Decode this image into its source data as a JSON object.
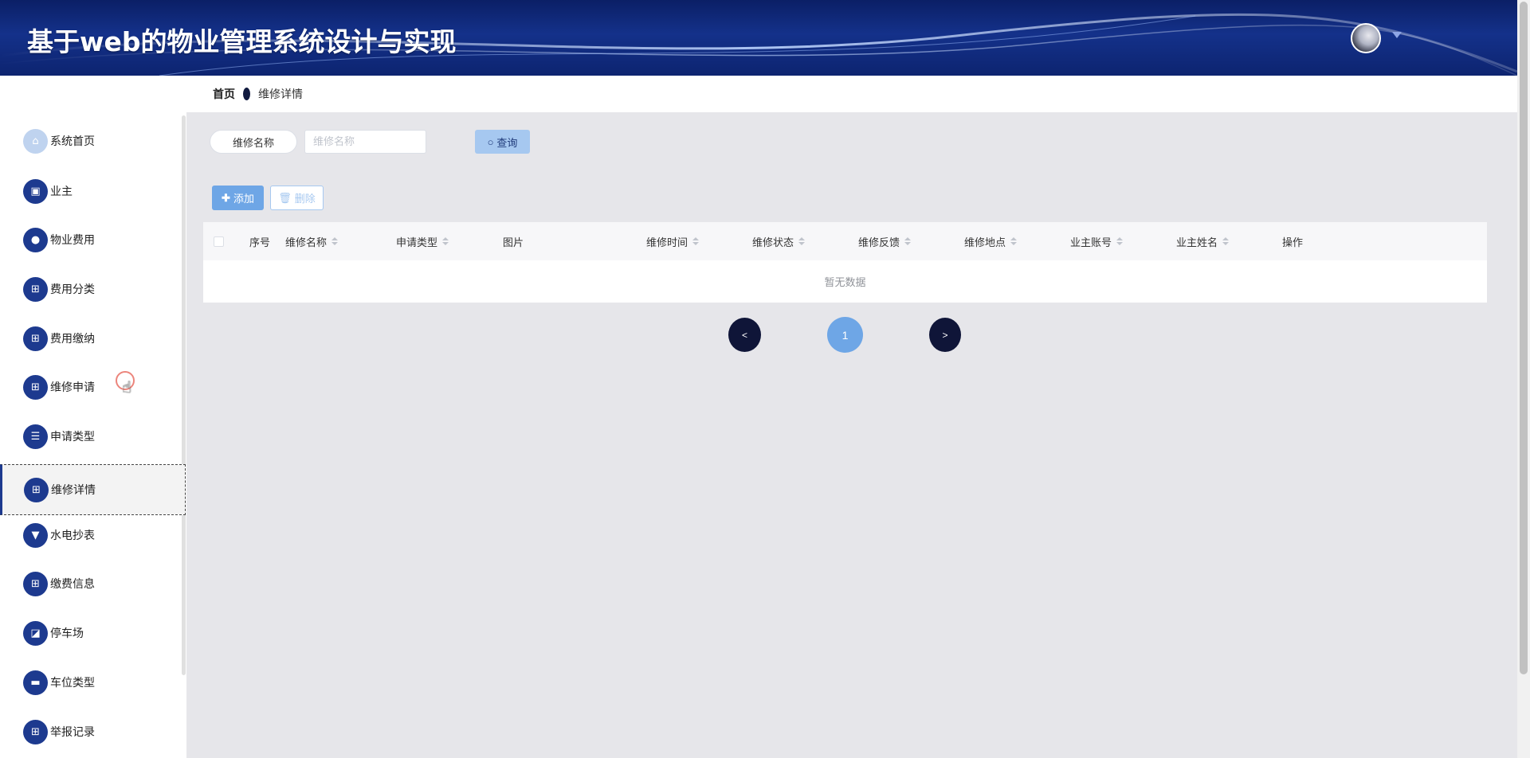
{
  "header": {
    "title": "基于web的物业管理系统设计与实现"
  },
  "breadcrumb": {
    "home": "首页",
    "current": "维修详情"
  },
  "sidebar": {
    "items": [
      {
        "label": "系统首页",
        "icon": "home-icon",
        "glyph": "⌂"
      },
      {
        "label": "业主",
        "icon": "briefcase-icon",
        "glyph": "▣"
      },
      {
        "label": "物业费用",
        "icon": "location-pin-icon",
        "glyph": "●"
      },
      {
        "label": "费用分类",
        "icon": "grid-icon",
        "glyph": "⊞"
      },
      {
        "label": "费用缴纳",
        "icon": "grid-icon",
        "glyph": "⊞"
      },
      {
        "label": "维修申请",
        "icon": "grid-icon",
        "glyph": "⊞"
      },
      {
        "label": "申请类型",
        "icon": "list-icon",
        "glyph": "☰"
      },
      {
        "label": "维修详情",
        "icon": "grid-icon",
        "glyph": "⊞"
      },
      {
        "label": "水电抄表",
        "icon": "brush-icon",
        "glyph": "▼"
      },
      {
        "label": "缴费信息",
        "icon": "grid-icon",
        "glyph": "⊞"
      },
      {
        "label": "停车场",
        "icon": "chart-icon",
        "glyph": "◪"
      },
      {
        "label": "车位类型",
        "icon": "message-icon",
        "glyph": "▬"
      },
      {
        "label": "举报记录",
        "icon": "grid-icon",
        "glyph": "⊞"
      }
    ],
    "active_index": 7
  },
  "search": {
    "label": "维修名称",
    "placeholder": "维修名称",
    "query_label": "查询"
  },
  "actions": {
    "add_label": "添加",
    "delete_label": "删除"
  },
  "table": {
    "columns": [
      "序号",
      "维修名称",
      "申请类型",
      "图片",
      "维修时间",
      "维修状态",
      "维修反馈",
      "维修地点",
      "业主账号",
      "业主姓名",
      "操作"
    ],
    "empty_text": "暂无数据"
  },
  "pagination": {
    "prev": "<",
    "current": "1",
    "next": ">"
  },
  "colors": {
    "header_bg": "#14318a",
    "sidebar_icon_bg": "#1d3a8f",
    "primary_button": "#6ea6e6",
    "page_button_dark": "#0f1538",
    "content_bg": "#e6e6ea"
  }
}
